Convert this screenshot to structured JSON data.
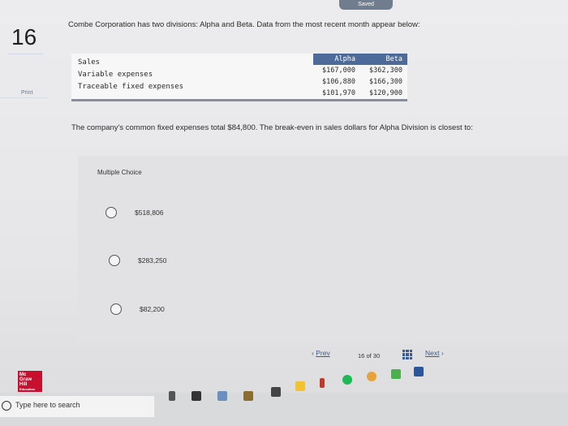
{
  "status": {
    "saved": "Saved"
  },
  "sidebar": {
    "question_number": "16",
    "print": "Print"
  },
  "question": {
    "intro": "Combe Corporation has two divisions: Alpha and Beta. Data from the most recent month appear below:",
    "table": {
      "columns": [
        "Alpha",
        "Beta"
      ],
      "rows": [
        {
          "label": "Sales",
          "alpha": "$167,000",
          "beta": "$362,300"
        },
        {
          "label": "Variable expenses",
          "alpha": "$106,880",
          "beta": "$166,300"
        },
        {
          "label": "Traceable fixed expenses",
          "alpha": "$101,970",
          "beta": "$120,900"
        }
      ]
    },
    "statement": "The company's common fixed expenses total $84,800. The break-even in sales dollars for Alpha Division is closest to:"
  },
  "multiple_choice": {
    "title": "Multiple Choice",
    "options": [
      "$518,806",
      "$283,250",
      "$82,200"
    ]
  },
  "navigation": {
    "prev": "Prev",
    "current": "16",
    "of": "of",
    "total": "30",
    "next": "Next"
  },
  "brand": {
    "line1": "Mc",
    "line2": "Graw",
    "line3": "Hill",
    "line4": "Education"
  },
  "taskbar": {
    "search_placeholder": "Type here to search"
  },
  "colors": {
    "accent": "#4d6b9a",
    "link": "#3a5c8e",
    "brand_red": "#c8102e"
  }
}
